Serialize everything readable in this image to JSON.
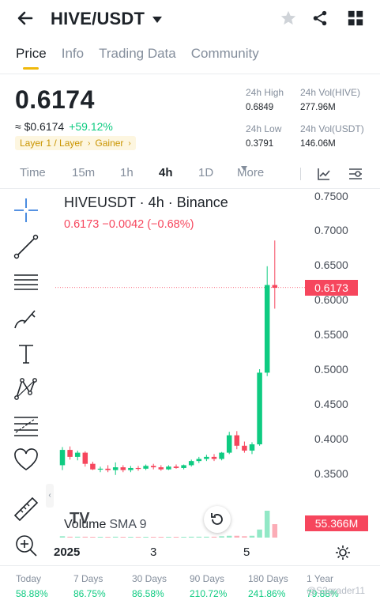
{
  "header": {
    "pair": "HIVE/USDT",
    "icons": [
      "back-arrow-icon",
      "star-icon",
      "share-icon",
      "grid-icon"
    ]
  },
  "tabs": [
    {
      "label": "Price",
      "active": true
    },
    {
      "label": "Info",
      "active": false
    },
    {
      "label": "Trading Data",
      "active": false
    },
    {
      "label": "Community",
      "active": false
    }
  ],
  "ticker": {
    "last_price": "0.6174",
    "fiat_price": "≈ $0.6174",
    "change_pct": "+59.12%",
    "tag_1": "Layer 1 / Layer",
    "tag_2": "Gainer",
    "tag_caret": "›",
    "high_label": "24h High",
    "high_value": "0.6849",
    "low_label": "24h Low",
    "low_value": "0.3791",
    "vol_base_label": "24h Vol(HIVE)",
    "vol_base_value": "277.96M",
    "vol_quote_label": "24h Vol(USDT)",
    "vol_quote_value": "146.06M"
  },
  "intervals": [
    {
      "label": "Time",
      "selected": false
    },
    {
      "label": "15m",
      "selected": false
    },
    {
      "label": "1h",
      "selected": false
    },
    {
      "label": "4h",
      "selected": true
    },
    {
      "label": "1D",
      "selected": false
    },
    {
      "label": "More",
      "selected": false
    }
  ],
  "tools": [
    "crosshair-icon",
    "trend-line-icon",
    "horizontal-lines-icon",
    "brush-icon",
    "text-icon",
    "pattern-icon",
    "fib-icon",
    "heart-icon",
    "ruler-icon",
    "zoom-in-icon"
  ],
  "chart": {
    "title": "HIVEUSDT · 4h · Binance",
    "ohlc_summary": "0.6173  −0.0042 (−0.68%)",
    "price_tag": "0.6173",
    "volume_label": "Volume",
    "sma_label": "SMA 9",
    "volume_tag": "55.366M",
    "tv_logo": "TV"
  },
  "chart_data": {
    "type": "candlestick",
    "y_ticks": [
      "0.7500",
      "0.7000",
      "0.6500",
      "0.6000",
      "0.5500",
      "0.5000",
      "0.4500",
      "0.4000",
      "0.3500"
    ],
    "ylim": [
      0.3,
      0.75
    ],
    "x_ticks": [
      "2025",
      "3",
      "5"
    ],
    "last_price_line": 0.6173,
    "candles": [
      {
        "o": 0.362,
        "h": 0.388,
        "l": 0.355,
        "c": 0.384
      },
      {
        "o": 0.384,
        "h": 0.389,
        "l": 0.37,
        "c": 0.374
      },
      {
        "o": 0.374,
        "h": 0.383,
        "l": 0.369,
        "c": 0.38
      },
      {
        "o": 0.38,
        "h": 0.382,
        "l": 0.36,
        "c": 0.364
      },
      {
        "o": 0.364,
        "h": 0.367,
        "l": 0.355,
        "c": 0.356
      },
      {
        "o": 0.356,
        "h": 0.36,
        "l": 0.352,
        "c": 0.357
      },
      {
        "o": 0.357,
        "h": 0.362,
        "l": 0.352,
        "c": 0.355
      },
      {
        "o": 0.355,
        "h": 0.366,
        "l": 0.348,
        "c": 0.359
      },
      {
        "o": 0.359,
        "h": 0.362,
        "l": 0.352,
        "c": 0.355
      },
      {
        "o": 0.355,
        "h": 0.361,
        "l": 0.352,
        "c": 0.358
      },
      {
        "o": 0.358,
        "h": 0.361,
        "l": 0.354,
        "c": 0.357
      },
      {
        "o": 0.357,
        "h": 0.363,
        "l": 0.355,
        "c": 0.361
      },
      {
        "o": 0.361,
        "h": 0.364,
        "l": 0.356,
        "c": 0.359
      },
      {
        "o": 0.359,
        "h": 0.362,
        "l": 0.354,
        "c": 0.356
      },
      {
        "o": 0.356,
        "h": 0.362,
        "l": 0.355,
        "c": 0.36
      },
      {
        "o": 0.36,
        "h": 0.363,
        "l": 0.357,
        "c": 0.358
      },
      {
        "o": 0.358,
        "h": 0.363,
        "l": 0.356,
        "c": 0.362
      },
      {
        "o": 0.362,
        "h": 0.37,
        "l": 0.36,
        "c": 0.368
      },
      {
        "o": 0.368,
        "h": 0.374,
        "l": 0.365,
        "c": 0.371
      },
      {
        "o": 0.371,
        "h": 0.377,
        "l": 0.368,
        "c": 0.374
      },
      {
        "o": 0.374,
        "h": 0.378,
        "l": 0.368,
        "c": 0.371
      },
      {
        "o": 0.371,
        "h": 0.381,
        "l": 0.369,
        "c": 0.38
      },
      {
        "o": 0.38,
        "h": 0.41,
        "l": 0.378,
        "c": 0.405
      },
      {
        "o": 0.405,
        "h": 0.411,
        "l": 0.385,
        "c": 0.39
      },
      {
        "o": 0.39,
        "h": 0.396,
        "l": 0.38,
        "c": 0.383
      },
      {
        "o": 0.383,
        "h": 0.395,
        "l": 0.378,
        "c": 0.392
      },
      {
        "o": 0.392,
        "h": 0.5,
        "l": 0.39,
        "c": 0.495
      },
      {
        "o": 0.495,
        "h": 0.648,
        "l": 0.49,
        "c": 0.621
      },
      {
        "o": 0.621,
        "h": 0.685,
        "l": 0.587,
        "c": 0.617
      }
    ],
    "volumes": [
      3,
      2,
      2,
      2,
      1,
      1,
      1,
      2,
      1,
      1,
      1,
      1,
      1,
      1,
      1,
      1,
      1,
      2,
      2,
      2,
      2,
      3,
      4,
      4,
      3,
      4,
      18,
      60,
      30
    ]
  },
  "performance": [
    {
      "label": "Today",
      "value": "58.88%"
    },
    {
      "label": "7 Days",
      "value": "86.75%"
    },
    {
      "label": "30 Days",
      "value": "86.58%"
    },
    {
      "label": "90 Days",
      "value": "210.72%"
    },
    {
      "label": "180 Days",
      "value": "241.86%"
    },
    {
      "label": "1 Year",
      "value": "79.88%"
    }
  ],
  "watermark": "@S3grader11",
  "colors": {
    "up": "#0ecb81",
    "down": "#f6465d",
    "accent": "#f0b90b",
    "muted": "#848e9c"
  }
}
